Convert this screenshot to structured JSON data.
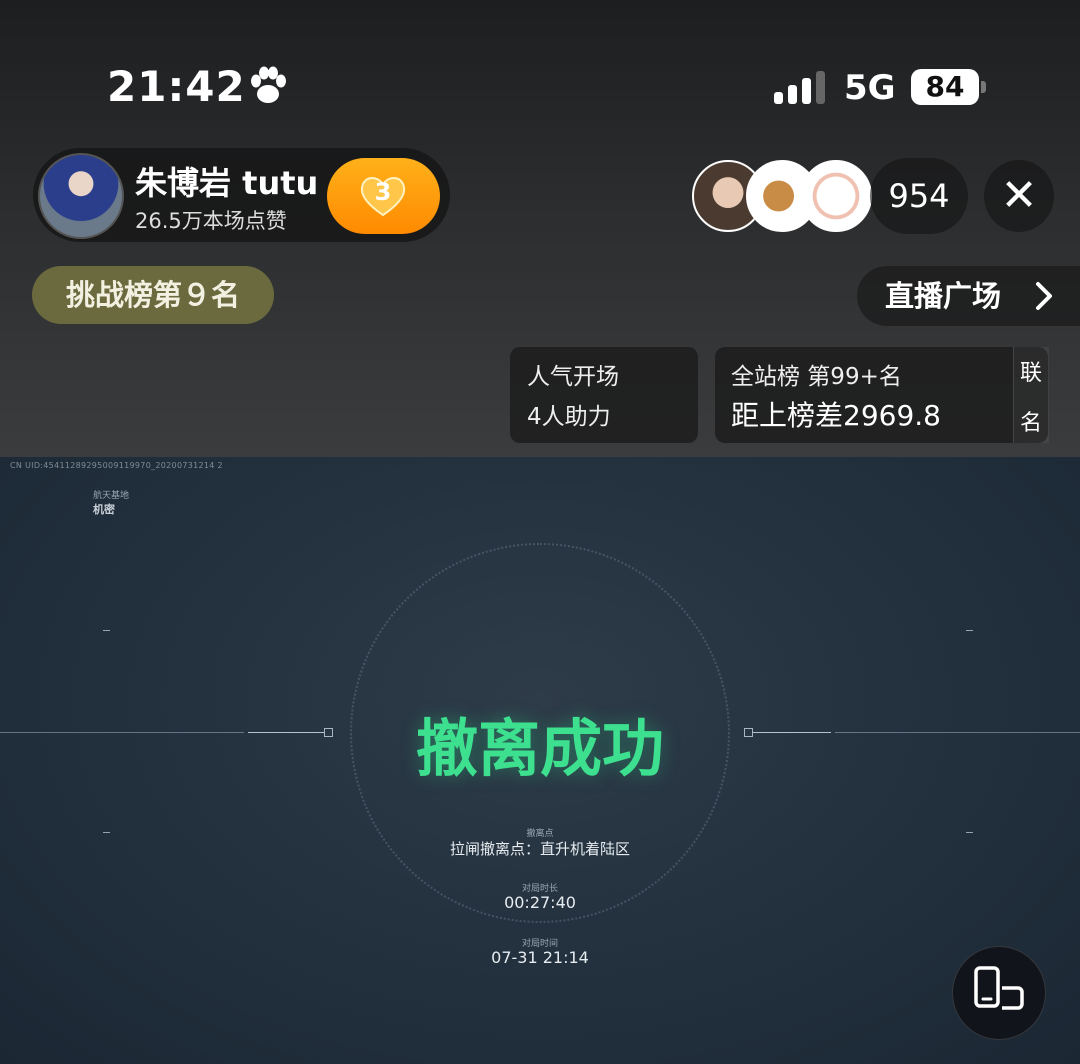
{
  "status_bar": {
    "time": "21:42",
    "network": "5G",
    "battery": "84"
  },
  "host": {
    "name": "朱博岩 tutu",
    "likes": "26.5万本场点赞",
    "fan_level": "3"
  },
  "viewers": {
    "count": "954"
  },
  "badges": {
    "challenge": "挑战榜第９名",
    "plaza": "直播广场"
  },
  "rank_cards": {
    "popularity_line1": "人气开场",
    "popularity_line2": "4人助力",
    "site_rank_line1": "全站榜 第99+名",
    "site_rank_line2": "距上榜差2969.8",
    "side_tab_1": "联",
    "side_tab_2": "名"
  },
  "game": {
    "uid": "CN UID:45411289295009119970_20200731214 2",
    "map_label": "航天基地",
    "map_name": "机密",
    "result_title": "撤离成功",
    "point_label": "撤离点",
    "point_value": "拉闸撤离点：直升机着陆区",
    "duration_label": "对局时长",
    "duration_value": "00:27:40",
    "time_label": "对局时间",
    "time_value": "07-31 21:14"
  },
  "colors": {
    "accent_green": "#3de08e",
    "fan_orange": "#ff9a0d",
    "challenge_olive": "#6b6a3e"
  },
  "icons": [
    "paw-icon",
    "signal-icon",
    "heart-icon",
    "close-icon",
    "chevron-right-icon",
    "rotate-screen-icon"
  ]
}
